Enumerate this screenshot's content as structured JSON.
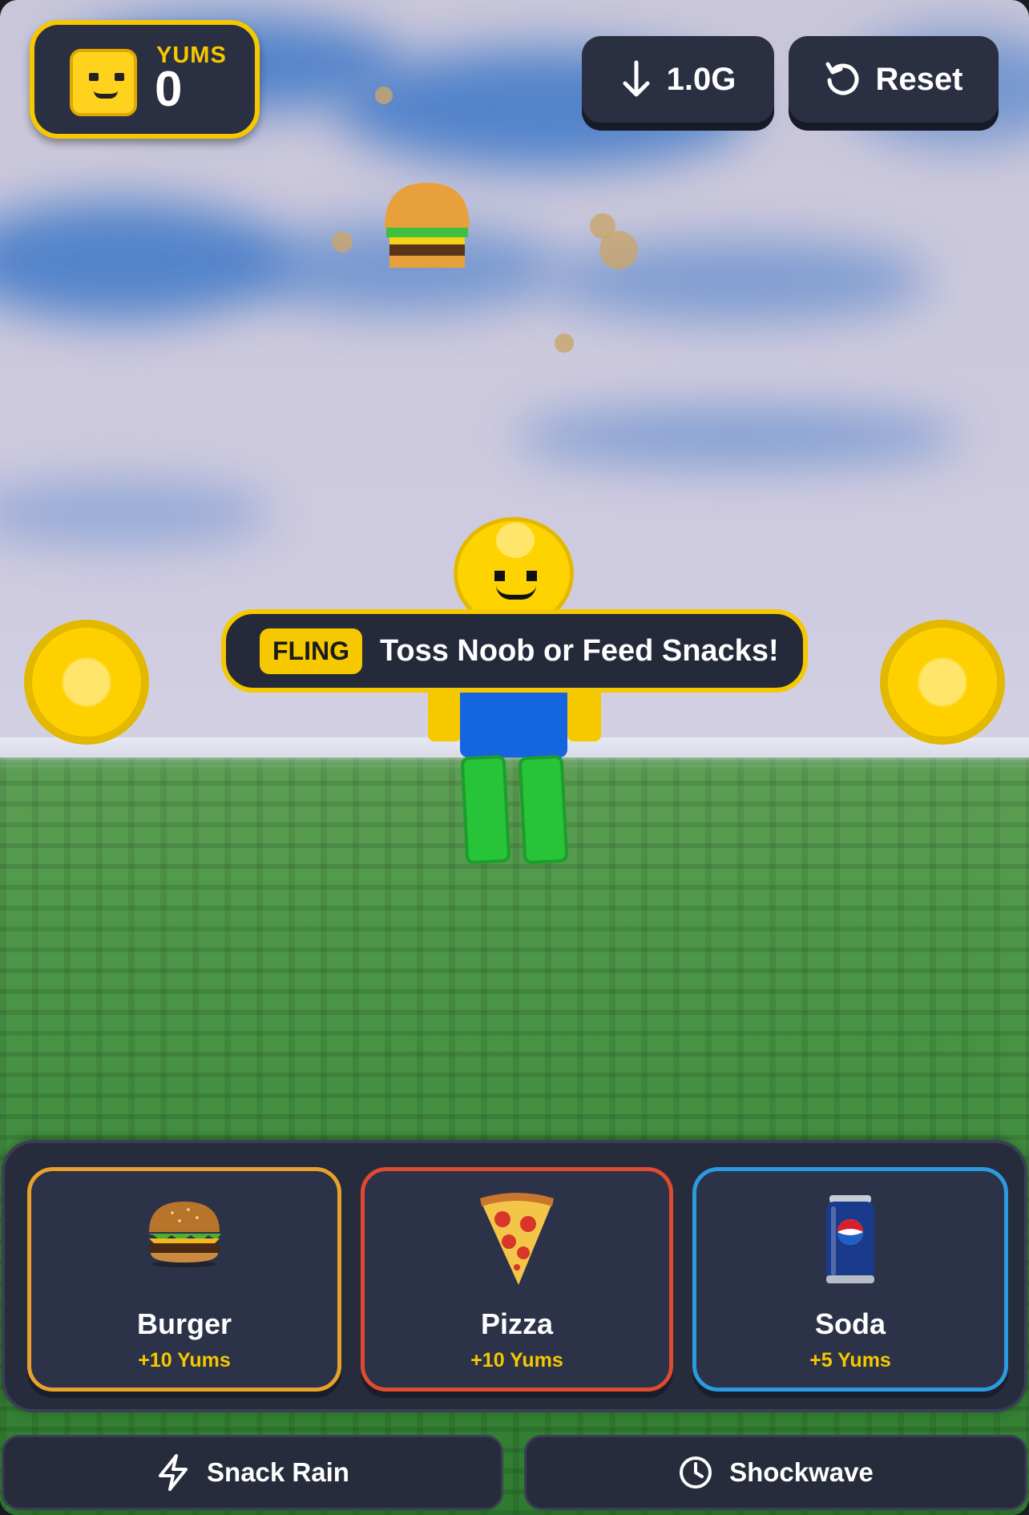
{
  "hud": {
    "yums_label": "YUMS",
    "yums_value": "0",
    "gravity_label": "1.0G",
    "reset_label": "Reset"
  },
  "banner": {
    "tag": "FLING",
    "text": "Toss Noob or Feed Snacks!"
  },
  "snacks": [
    {
      "name": "Burger",
      "reward": "+10 Yums",
      "icon": "burger-icon",
      "color": "#e8a22c"
    },
    {
      "name": "Pizza",
      "reward": "+10 Yums",
      "icon": "pizza-icon",
      "color": "#e04a2f"
    },
    {
      "name": "Soda",
      "reward": "+5 Yums",
      "icon": "soda-can-icon",
      "color": "#2b9be0"
    }
  ],
  "actions": {
    "snack_rain": "Snack Rain",
    "shockwave": "Shockwave"
  },
  "colors": {
    "accent": "#f5c800",
    "panel": "#2a2f42",
    "noob_head": "#fdd300",
    "noob_torso": "#1565e0",
    "noob_legs": "#27c338"
  }
}
